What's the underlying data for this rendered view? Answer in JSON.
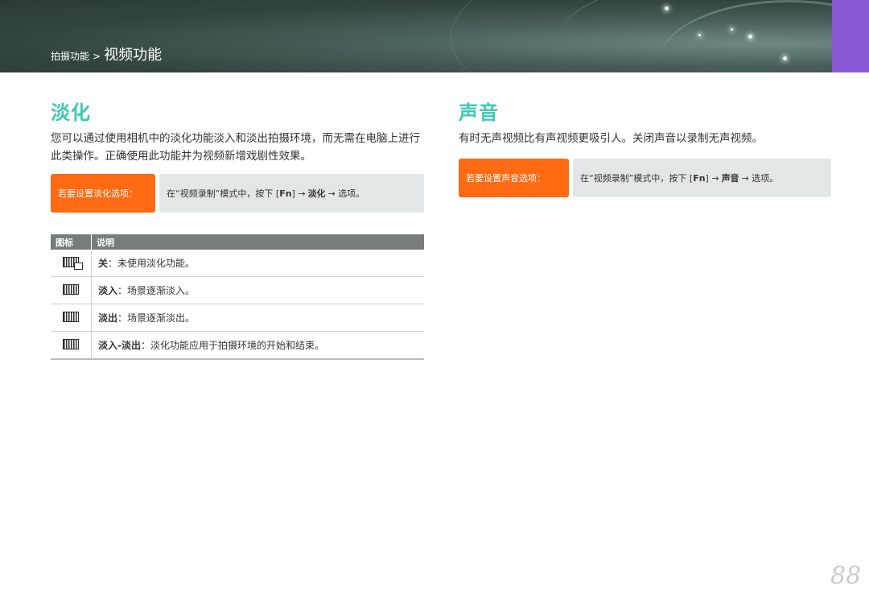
{
  "header": {
    "breadcrumb_section": "拍摄功能",
    "breadcrumb_separator": ">",
    "breadcrumb_title": "视频功能"
  },
  "fade": {
    "title": "淡化",
    "description": "您可以通过使用相机中的淡化功能淡入和淡出拍摄环境，而无需在电脑上进行此类操作。正确使用此功能并为视频新增戏剧性效果。",
    "tip_label": "若要设置淡化选项：",
    "tip_text_prefix": "在“视频录制”模式中，按下 [",
    "tip_key": "Fn",
    "tip_text_mid": "] → ",
    "tip_menu": "淡化",
    "tip_text_suffix": "→ 选项。",
    "table": {
      "headers": [
        "图标",
        "说明"
      ],
      "rows": [
        {
          "icon": "fade-off-icon",
          "term": "关",
          "sep": "：",
          "desc": "未使用淡化功能。"
        },
        {
          "icon": "fade-in-icon",
          "term": "淡入",
          "sep": "：",
          "desc": "场景逐渐淡入。"
        },
        {
          "icon": "fade-out-icon",
          "term": "淡出",
          "sep": "：",
          "desc": "场景逐渐淡出。"
        },
        {
          "icon": "fade-in-out-icon",
          "term": "淡入-淡出",
          "sep": "：",
          "desc": "淡化功能应用于拍摄环境的开始和结束。"
        }
      ]
    }
  },
  "sound": {
    "title": "声音",
    "description": "有时无声视频比有声视频更吸引人。关闭声音以录制无声视频。",
    "tip_label": "若要设置声音选项：",
    "tip_text_prefix": "在“视频录制”模式中，按下 [",
    "tip_key": "Fn",
    "tip_text_mid": "] → ",
    "tip_menu": "声音",
    "tip_text_suffix": "→ 选项。"
  },
  "page_number": "88",
  "colors": {
    "accent_title": "#3fc8b4",
    "tip_label": "#ff6a13",
    "tip_content": "#e2e6e7",
    "table_header": "#777c7d",
    "tab_accent": "#8a5ad6"
  }
}
